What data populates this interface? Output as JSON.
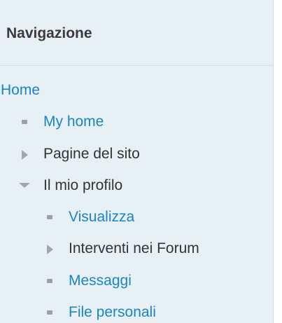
{
  "block": {
    "title": "Navigazione"
  },
  "nav": {
    "home": "Home",
    "my_home": "My home",
    "site_pages": "Pagine del sito",
    "my_profile": "Il mio profilo",
    "view": "Visualizza",
    "forum_posts": "Interventi nei Forum",
    "messages": "Messaggi",
    "personal_files": "File personali"
  },
  "colors": {
    "link": "#1a84c6",
    "text": "#333333",
    "block_background": "#e7f0f4"
  }
}
